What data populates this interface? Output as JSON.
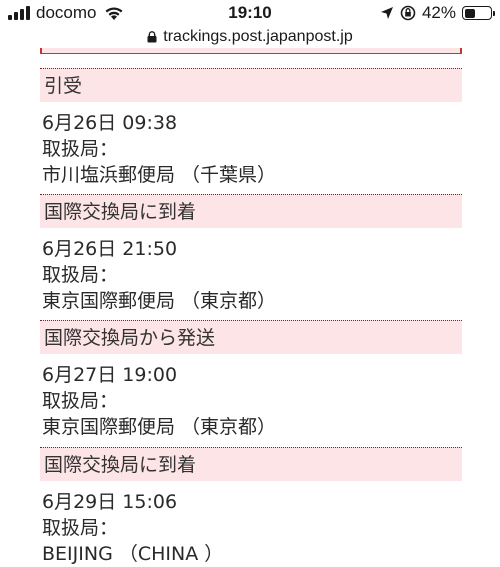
{
  "status_bar": {
    "carrier": "docomo",
    "time": "19:10",
    "battery": "42%",
    "battery_level": 0.42
  },
  "url_bar": {
    "url": "trackings.post.japanpost.jp"
  },
  "events": [
    {
      "status": "引受",
      "datetime": "6月26日 09:38",
      "office_label": "取扱局：",
      "office": "市川塩浜郵便局 （千葉県）"
    },
    {
      "status": "国際交換局に到着",
      "datetime": "6月26日 21:50",
      "office_label": "取扱局：",
      "office": "東京国際郵便局 （東京都）"
    },
    {
      "status": "国際交換局から発送",
      "datetime": "6月27日 19:00",
      "office_label": "取扱局：",
      "office": "東京国際郵便局 （東京都）"
    },
    {
      "status": "国際交換局に到着",
      "datetime": "6月29日 15:06",
      "office_label": "取扱局：",
      "office": "BEIJING （CHINA ）"
    }
  ]
}
